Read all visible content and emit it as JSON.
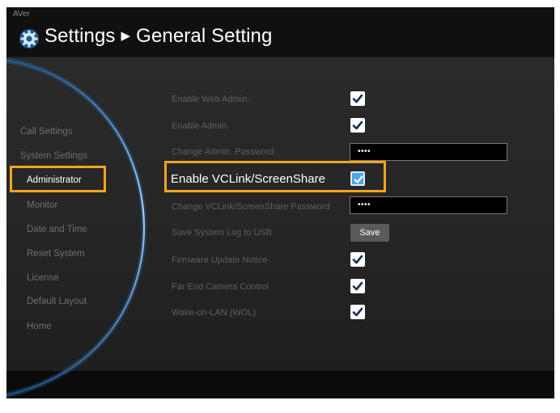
{
  "header": {
    "brand": "AVer",
    "title": "Settings",
    "subtitle": "General Setting"
  },
  "sidebar": {
    "items": [
      {
        "label": "Call Settings",
        "active": false
      },
      {
        "label": "System Settings",
        "active": false
      },
      {
        "label": "Administrator",
        "active": true
      },
      {
        "label": "Monitor",
        "active": false
      },
      {
        "label": "Date and Time",
        "active": false
      },
      {
        "label": "Reset System",
        "active": false
      },
      {
        "label": "License",
        "active": false
      },
      {
        "label": "Default Layout",
        "active": false
      },
      {
        "label": "Home",
        "active": false
      }
    ]
  },
  "settings": {
    "enable_web_admin": {
      "label": "Enable Web Admin.",
      "checked": true
    },
    "enable_admin": {
      "label": "Enable Admin.",
      "checked": true
    },
    "change_admin_password": {
      "label": "Change Admin. Password",
      "value": "••••"
    },
    "enable_vclink": {
      "label": "Enable VCLink/ScreenShare",
      "checked": true
    },
    "change_vclink_password": {
      "label": "Change VCLink/ScreenShare Password",
      "value": "••••"
    },
    "save_log": {
      "label": "Save System Log to USB",
      "button": "Save"
    },
    "firmware_notice": {
      "label": "Firmware Update Notice",
      "checked": true
    },
    "far_end_camera": {
      "label": "Far End Camera Control",
      "checked": true
    },
    "wake_on_lan": {
      "label": "Wake-on-LAN (WOL)",
      "checked": true
    }
  },
  "colors": {
    "highlight": "#f2a51d",
    "accent_blue": "#4ea6ea",
    "background": "#151515"
  }
}
